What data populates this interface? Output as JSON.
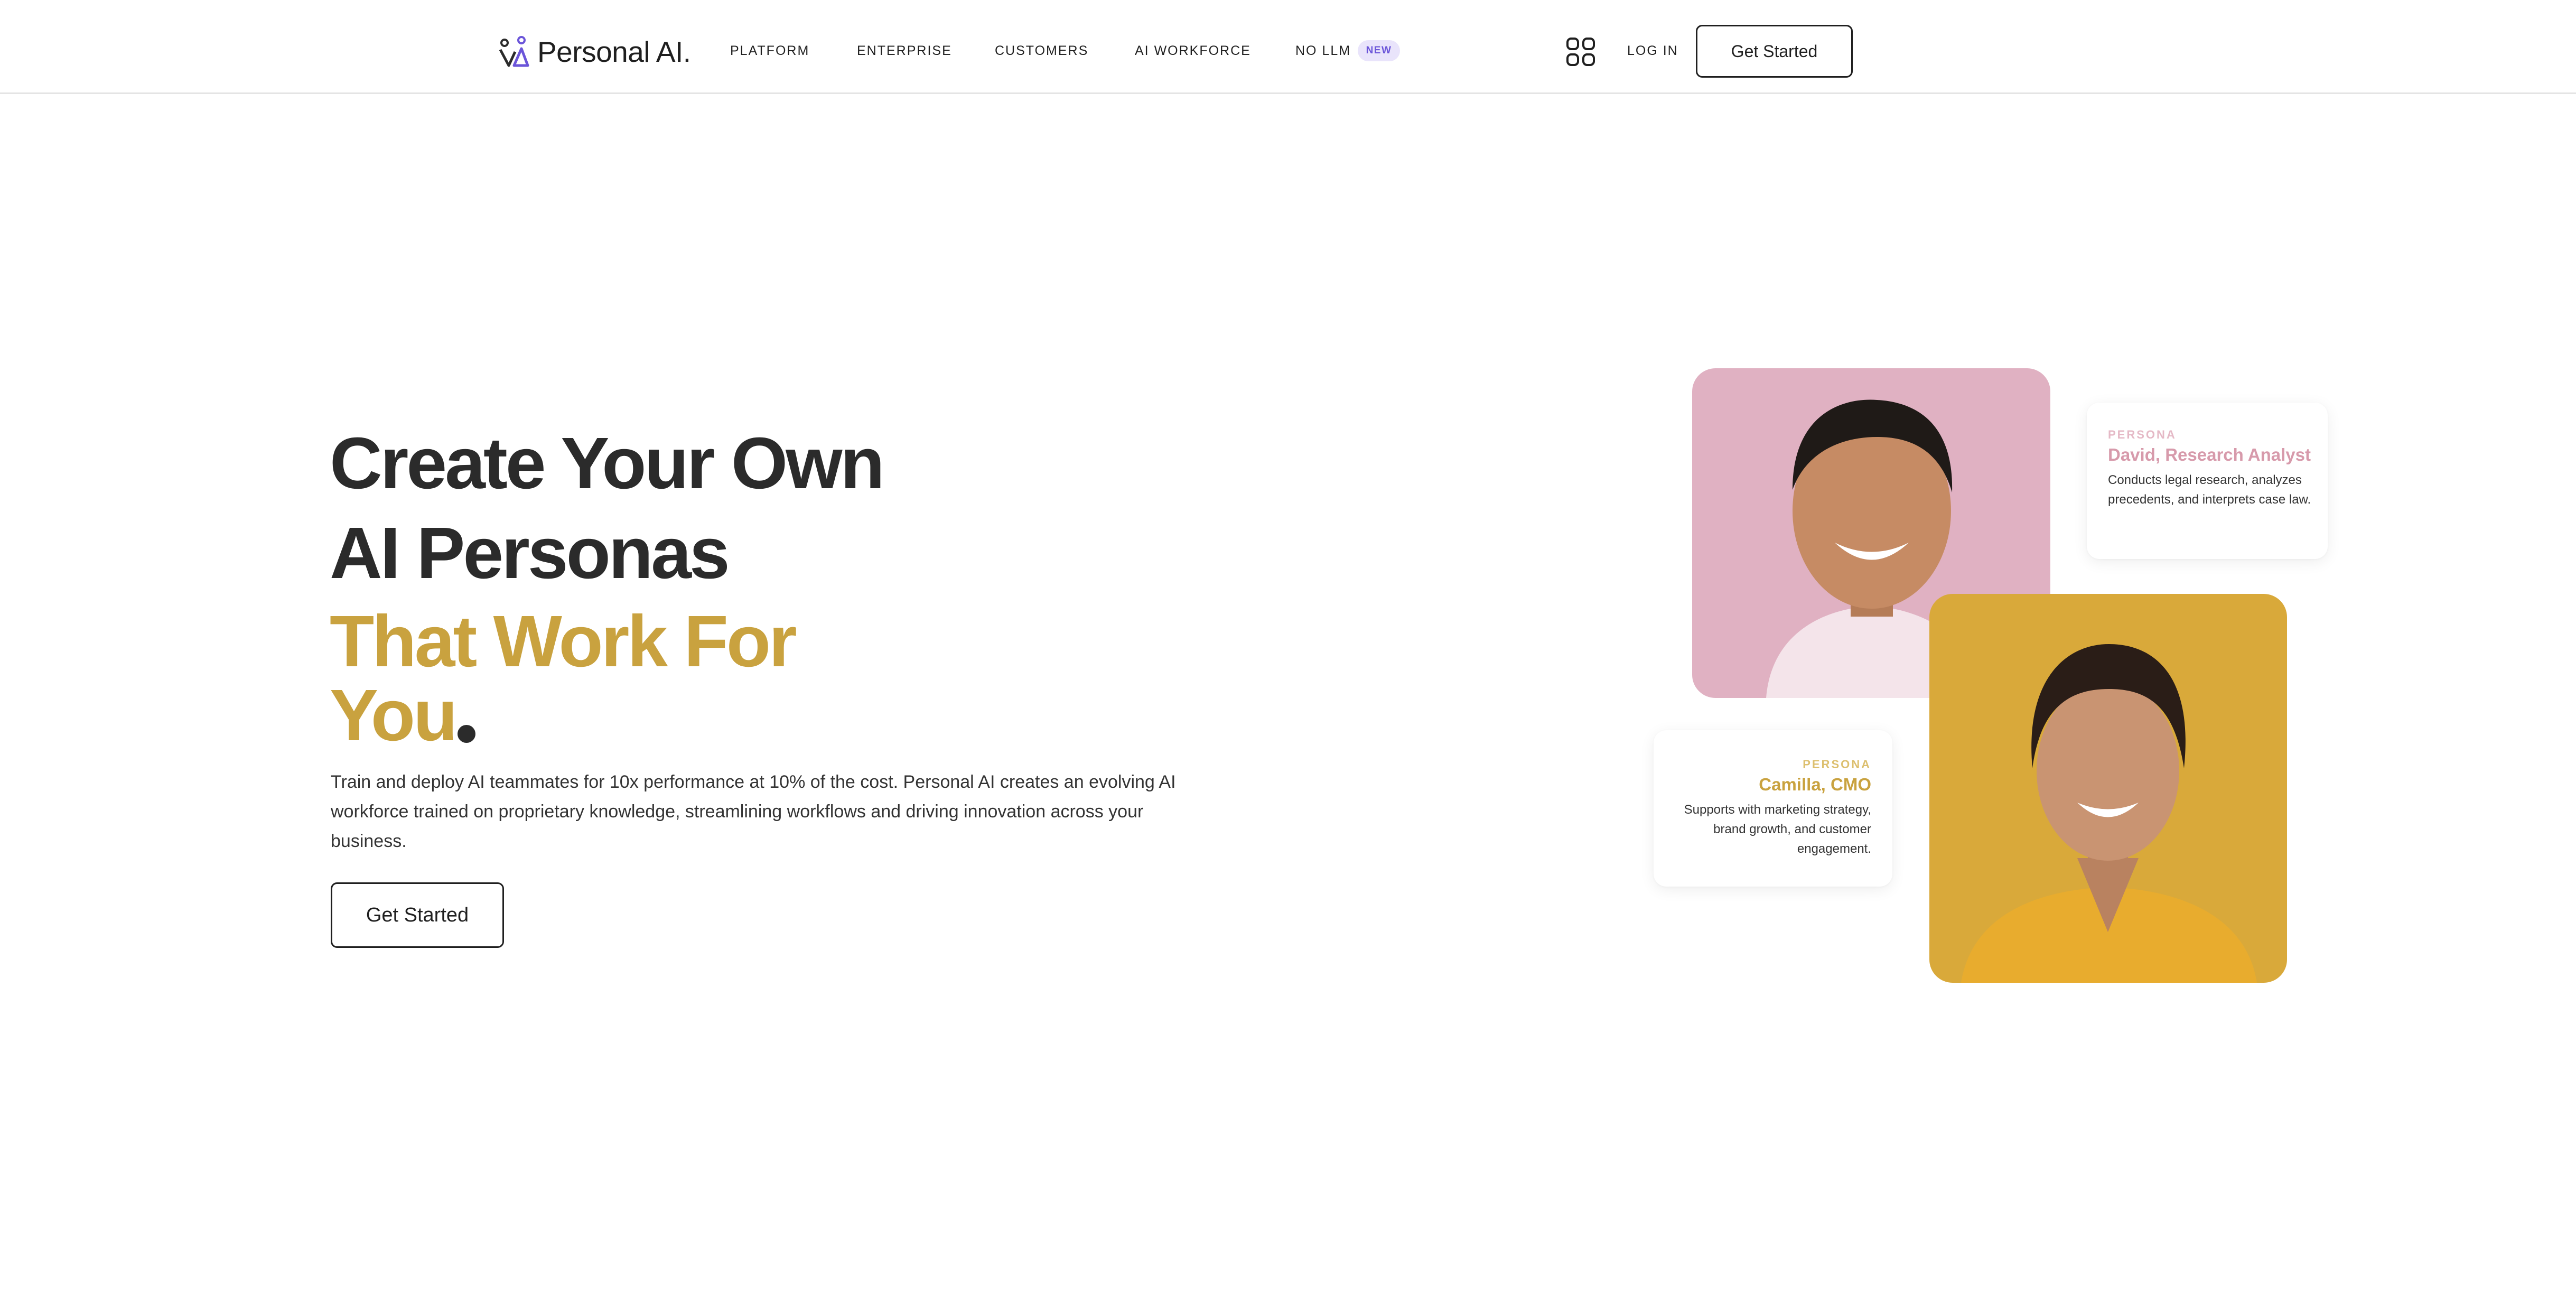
{
  "brand": {
    "name": "Personal AI."
  },
  "nav": {
    "items": [
      "PLATFORM",
      "ENTERPRISE",
      "CUSTOMERS",
      "AI WORKFORCE",
      "NO LLM"
    ],
    "badge": "NEW",
    "login": "LOG IN",
    "cta": "Get Started"
  },
  "hero": {
    "line1": "Create Your Own",
    "line2": "AI Personas",
    "line3": "That Work For",
    "line4": "You",
    "description": "Train and deploy AI teammates for 10x performance at 10% of the cost. Personal AI creates an evolving AI workforce trained on proprietary knowledge, streamlining workflows and driving innovation across your business.",
    "cta": "Get Started"
  },
  "personas": [
    {
      "label": "PERSONA",
      "name": "David, Research Analyst",
      "description": "Conducts legal research, analyzes precedents, and interprets case law.",
      "accent": "#d79aab",
      "photo_bg": "#e0b1c2"
    },
    {
      "label": "PERSONA",
      "name": "Camilla, CMO",
      "description": "Supports with marketing strategy, brand growth, and customer engagement.",
      "accent": "#c9a23f",
      "photo_bg": "#d9a93a"
    }
  ],
  "colors": {
    "gold": "#c9a23f",
    "dark": "#2b2b2b",
    "badge_bg": "#e9e4fb",
    "badge_text": "#6b55d9"
  }
}
